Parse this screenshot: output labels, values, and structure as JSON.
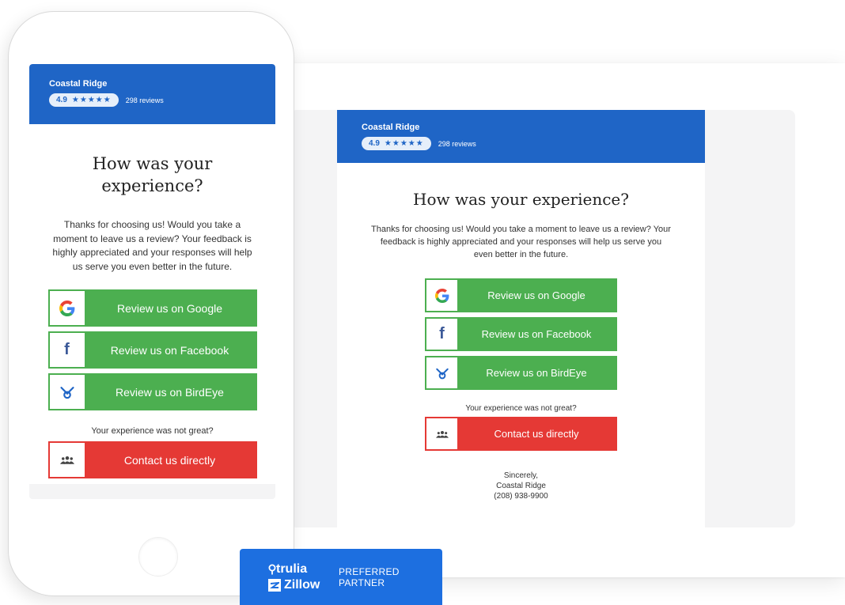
{
  "business": {
    "name": "Coastal Ridge",
    "rating": "4.9",
    "stars": "★★★★★",
    "reviews": "298 reviews",
    "phone": "(208) 938-9900"
  },
  "email": {
    "title_desktop": "How was your experience?",
    "title_mobile": "How was your experience?",
    "body": "Thanks for choosing us! Would you take a moment to leave us a review? Your feedback is highly appreciated and your responses will help us serve you even better in the future.",
    "buttons": [
      {
        "label": "Review us on Google",
        "icon": "google-icon"
      },
      {
        "label": "Review us on Facebook",
        "icon": "facebook-icon"
      },
      {
        "label": "Review us on BirdEye",
        "icon": "birdeye-icon"
      }
    ],
    "not_great": "Your experience was not great?",
    "contact_label": "Contact us directly",
    "contact_icon": "people-icon",
    "sign_off": "Sincerely,"
  },
  "partner": {
    "trulia": "trulia",
    "zillow": "Zillow",
    "line1": "PREFERRED",
    "line2": "PARTNER"
  },
  "colors": {
    "header_blue": "#1f65c6",
    "green": "#4caf50",
    "red": "#e53935",
    "badge_blue": "#1d6fe0"
  }
}
